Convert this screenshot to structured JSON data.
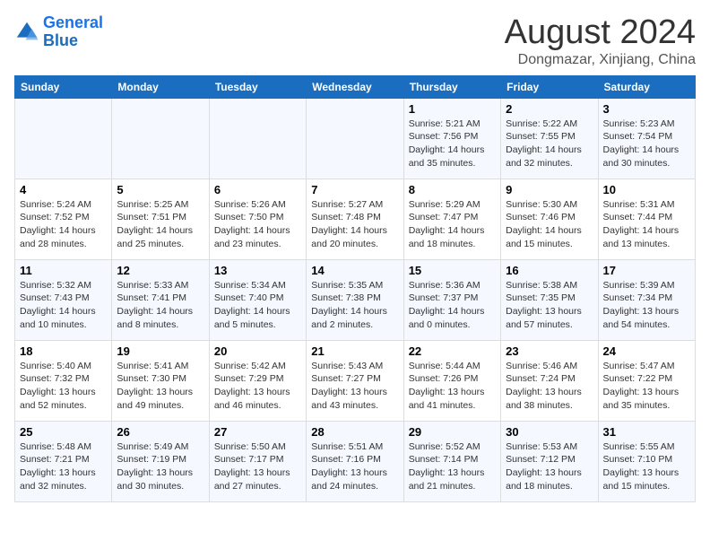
{
  "logo": {
    "text_general": "General",
    "text_blue": "Blue"
  },
  "title": "August 2024",
  "subtitle": "Dongmazar, Xinjiang, China",
  "days_of_week": [
    "Sunday",
    "Monday",
    "Tuesday",
    "Wednesday",
    "Thursday",
    "Friday",
    "Saturday"
  ],
  "weeks": [
    [
      {
        "day": "",
        "info": ""
      },
      {
        "day": "",
        "info": ""
      },
      {
        "day": "",
        "info": ""
      },
      {
        "day": "",
        "info": ""
      },
      {
        "day": "1",
        "info": "Sunrise: 5:21 AM\nSunset: 7:56 PM\nDaylight: 14 hours\nand 35 minutes."
      },
      {
        "day": "2",
        "info": "Sunrise: 5:22 AM\nSunset: 7:55 PM\nDaylight: 14 hours\nand 32 minutes."
      },
      {
        "day": "3",
        "info": "Sunrise: 5:23 AM\nSunset: 7:54 PM\nDaylight: 14 hours\nand 30 minutes."
      }
    ],
    [
      {
        "day": "4",
        "info": "Sunrise: 5:24 AM\nSunset: 7:52 PM\nDaylight: 14 hours\nand 28 minutes."
      },
      {
        "day": "5",
        "info": "Sunrise: 5:25 AM\nSunset: 7:51 PM\nDaylight: 14 hours\nand 25 minutes."
      },
      {
        "day": "6",
        "info": "Sunrise: 5:26 AM\nSunset: 7:50 PM\nDaylight: 14 hours\nand 23 minutes."
      },
      {
        "day": "7",
        "info": "Sunrise: 5:27 AM\nSunset: 7:48 PM\nDaylight: 14 hours\nand 20 minutes."
      },
      {
        "day": "8",
        "info": "Sunrise: 5:29 AM\nSunset: 7:47 PM\nDaylight: 14 hours\nand 18 minutes."
      },
      {
        "day": "9",
        "info": "Sunrise: 5:30 AM\nSunset: 7:46 PM\nDaylight: 14 hours\nand 15 minutes."
      },
      {
        "day": "10",
        "info": "Sunrise: 5:31 AM\nSunset: 7:44 PM\nDaylight: 14 hours\nand 13 minutes."
      }
    ],
    [
      {
        "day": "11",
        "info": "Sunrise: 5:32 AM\nSunset: 7:43 PM\nDaylight: 14 hours\nand 10 minutes."
      },
      {
        "day": "12",
        "info": "Sunrise: 5:33 AM\nSunset: 7:41 PM\nDaylight: 14 hours\nand 8 minutes."
      },
      {
        "day": "13",
        "info": "Sunrise: 5:34 AM\nSunset: 7:40 PM\nDaylight: 14 hours\nand 5 minutes."
      },
      {
        "day": "14",
        "info": "Sunrise: 5:35 AM\nSunset: 7:38 PM\nDaylight: 14 hours\nand 2 minutes."
      },
      {
        "day": "15",
        "info": "Sunrise: 5:36 AM\nSunset: 7:37 PM\nDaylight: 14 hours\nand 0 minutes."
      },
      {
        "day": "16",
        "info": "Sunrise: 5:38 AM\nSunset: 7:35 PM\nDaylight: 13 hours\nand 57 minutes."
      },
      {
        "day": "17",
        "info": "Sunrise: 5:39 AM\nSunset: 7:34 PM\nDaylight: 13 hours\nand 54 minutes."
      }
    ],
    [
      {
        "day": "18",
        "info": "Sunrise: 5:40 AM\nSunset: 7:32 PM\nDaylight: 13 hours\nand 52 minutes."
      },
      {
        "day": "19",
        "info": "Sunrise: 5:41 AM\nSunset: 7:30 PM\nDaylight: 13 hours\nand 49 minutes."
      },
      {
        "day": "20",
        "info": "Sunrise: 5:42 AM\nSunset: 7:29 PM\nDaylight: 13 hours\nand 46 minutes."
      },
      {
        "day": "21",
        "info": "Sunrise: 5:43 AM\nSunset: 7:27 PM\nDaylight: 13 hours\nand 43 minutes."
      },
      {
        "day": "22",
        "info": "Sunrise: 5:44 AM\nSunset: 7:26 PM\nDaylight: 13 hours\nand 41 minutes."
      },
      {
        "day": "23",
        "info": "Sunrise: 5:46 AM\nSunset: 7:24 PM\nDaylight: 13 hours\nand 38 minutes."
      },
      {
        "day": "24",
        "info": "Sunrise: 5:47 AM\nSunset: 7:22 PM\nDaylight: 13 hours\nand 35 minutes."
      }
    ],
    [
      {
        "day": "25",
        "info": "Sunrise: 5:48 AM\nSunset: 7:21 PM\nDaylight: 13 hours\nand 32 minutes."
      },
      {
        "day": "26",
        "info": "Sunrise: 5:49 AM\nSunset: 7:19 PM\nDaylight: 13 hours\nand 30 minutes."
      },
      {
        "day": "27",
        "info": "Sunrise: 5:50 AM\nSunset: 7:17 PM\nDaylight: 13 hours\nand 27 minutes."
      },
      {
        "day": "28",
        "info": "Sunrise: 5:51 AM\nSunset: 7:16 PM\nDaylight: 13 hours\nand 24 minutes."
      },
      {
        "day": "29",
        "info": "Sunrise: 5:52 AM\nSunset: 7:14 PM\nDaylight: 13 hours\nand 21 minutes."
      },
      {
        "day": "30",
        "info": "Sunrise: 5:53 AM\nSunset: 7:12 PM\nDaylight: 13 hours\nand 18 minutes."
      },
      {
        "day": "31",
        "info": "Sunrise: 5:55 AM\nSunset: 7:10 PM\nDaylight: 13 hours\nand 15 minutes."
      }
    ]
  ]
}
